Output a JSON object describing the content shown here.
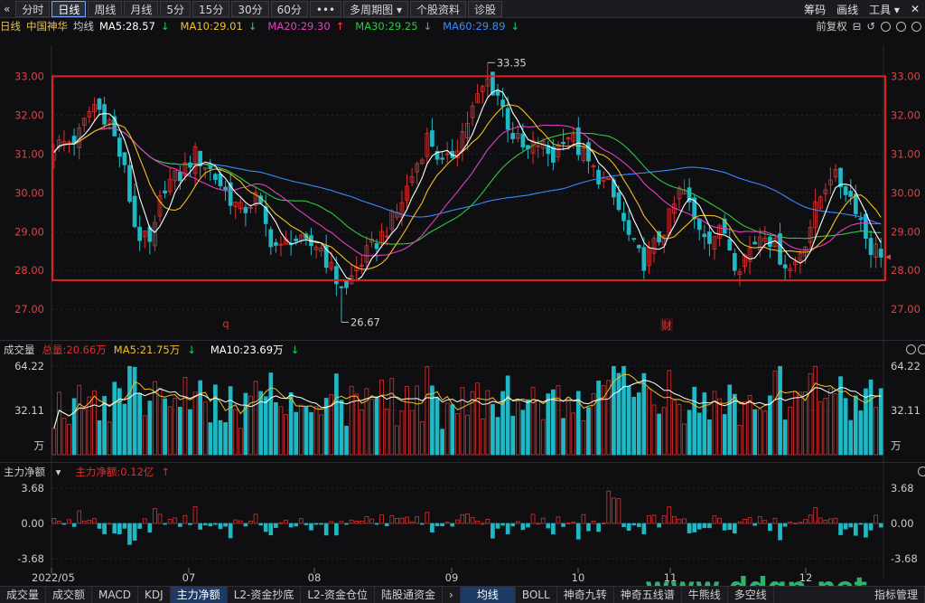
{
  "toolbar": {
    "back_icon": "«",
    "buttons": [
      "分时",
      "日线",
      "周线",
      "月线",
      "5分",
      "15分",
      "30分",
      "60分",
      "•••",
      "多周期图",
      "个股资料",
      "诊股"
    ],
    "active_index": 1,
    "dropdown_icon": "▾",
    "right": [
      "筹码",
      "画线",
      "工具"
    ],
    "right_dropdown": "▾",
    "close_icon": "✕"
  },
  "info": {
    "period": "日线",
    "stock": "中国神华",
    "ma_label": "均线",
    "ma5": "MA5:28.57",
    "ma10": "MA10:29.01",
    "ma20": "MA20:29.30",
    "ma30": "MA30:29.25",
    "ma60": "MA60:29.89",
    "ma5_arrow": "↓",
    "ma10_arrow": "↓",
    "ma20_arrow": "↑",
    "ma30_arrow": "↓",
    "ma60_arrow": "↓",
    "adjust": "前复权"
  },
  "colors": {
    "up": "#e0302e",
    "down": "#1fb8c4",
    "ma5": "#ffffff",
    "ma10": "#f0c020",
    "ma20": "#e040c0",
    "ma30": "#2ec840",
    "ma60": "#3a8aff",
    "box": "#e02020"
  },
  "price_axis": {
    "labels": [
      "33.00",
      "32.00",
      "31.00",
      "30.00",
      "29.00",
      "28.00",
      "27.00"
    ],
    "max": 33.8,
    "min": 26.4
  },
  "annotations": {
    "high": "33.35",
    "low": "26.67",
    "marker_q": "q",
    "marker_cai": "财"
  },
  "volume": {
    "label": "成交量",
    "total": "总量:20.66万",
    "ma5": "MA5:21.75万",
    "ma10": "MA10:23.69万",
    "ma5_arrow": "↓",
    "ma10_arrow": "↓",
    "axis": [
      "64.22",
      "32.11",
      "万"
    ]
  },
  "flow": {
    "label": "主力净额",
    "dropdown": "▾",
    "value": "主力净额:0.12亿",
    "arrow": "↑",
    "axis": [
      "3.68",
      "0.00",
      "-3.68"
    ]
  },
  "dates": [
    "2022/05",
    "07",
    "08",
    "09",
    "10",
    "11",
    "12"
  ],
  "bottom_tabs": [
    "成交量",
    "成交额",
    "MACD",
    "KDJ",
    "主力净额",
    "L2-资金抄底",
    "L2-资金仓位",
    "陆股通资金"
  ],
  "bottom_active": 4,
  "bottom_tabs2": [
    "均线",
    "BOLL",
    "神奇九转",
    "神奇五线谱",
    "牛熊线",
    "多空线"
  ],
  "bottom_active2": 0,
  "bottom_right": "指标管理",
  "nav_arrow": "›",
  "watermark": "www.ddgp.net",
  "chart_data": {
    "type": "candlestick",
    "title": "中国神华 日线",
    "ylim": [
      26.4,
      33.8
    ],
    "high": 33.35,
    "low": 26.67,
    "x_ticks": [
      "2022/05",
      "07",
      "08",
      "09",
      "10",
      "11",
      "12"
    ],
    "volume_ylim": [
      0,
      64.22
    ],
    "flow_ylim": [
      -3.68,
      3.68
    ]
  }
}
